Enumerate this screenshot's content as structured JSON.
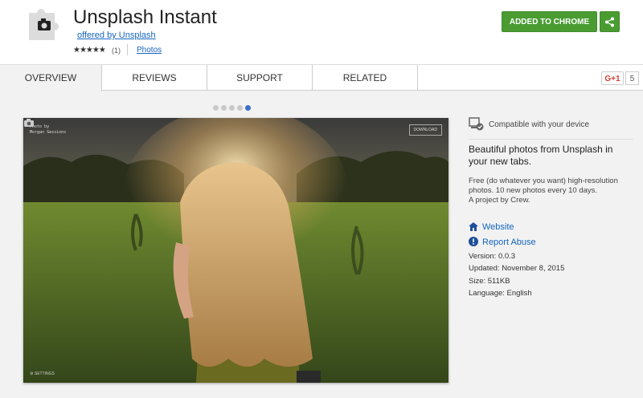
{
  "extension": {
    "title": "Unsplash Instant",
    "offered_by": "offered by Unsplash",
    "stars": "★★★★★",
    "rating_count": "(1)",
    "category": "Photos"
  },
  "actions": {
    "added_label": "ADDED TO CHROME",
    "share_icon": "share-icon"
  },
  "tabs": [
    "OVERVIEW",
    "REVIEWS",
    "SUPPORT",
    "RELATED"
  ],
  "gplus": {
    "label": "G+1",
    "count": "5"
  },
  "carousel": {
    "total": 5,
    "active_index": 4
  },
  "screenshot": {
    "credit_line1": "Photo by",
    "credit_line2": "Morgan Sessions",
    "download_label": "DOWNLOAD",
    "settings_label": "SETTINGS"
  },
  "sidebar": {
    "compat": "Compatible with your device",
    "description": "Beautiful photos from Unsplash in your new tabs.",
    "details": "Free (do whatever you want) high-resolution photos. 10 new photos every 10 days.",
    "credit": "A project by Crew.",
    "website": "Website",
    "report": "Report Abuse",
    "version": "Version: 0.0.3",
    "updated": "Updated: November 8, 2015",
    "size": "Size: 511KB",
    "language": "Language: English"
  },
  "colors": {
    "accent_green": "#4a9c32",
    "link_blue": "#1565c0",
    "active_dot": "#3a6fc4"
  }
}
